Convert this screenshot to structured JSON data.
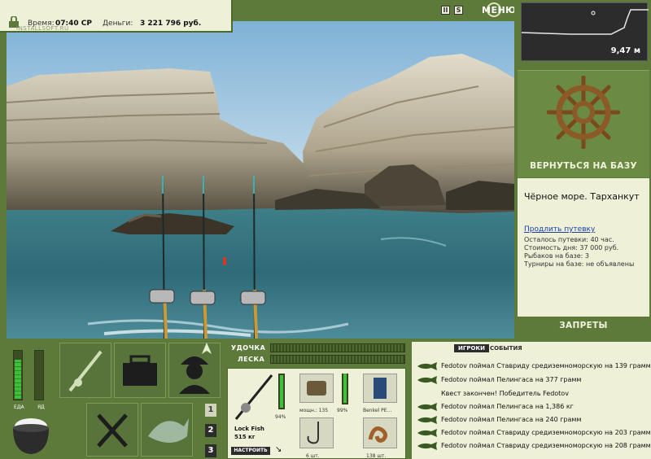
{
  "status": {
    "time_label": "Время:",
    "time_value": "07:40 СР",
    "money_label": "Деньги:",
    "money_value": "3 221 796 руб.",
    "watermark": "INSTALLSOFT.RU"
  },
  "toolbar": {
    "pause_label": "II",
    "sound_label": "S",
    "menu_label": "МЕНЮ"
  },
  "minimap": {
    "depth": "9,47 м"
  },
  "right_panel": {
    "return_label": "ВЕРНУТЬСЯ НА БАЗУ",
    "location": "Чёрное море. Тарханкут",
    "extend_link": "Продлить путевку",
    "info_lines": [
      "Осталось путевки: 40 час.",
      "Стоимость дня: 37 000 руб.",
      "Рыбаков на базе: 3",
      "Турниры на базе: не объявлены"
    ],
    "bans_label": "ЗАПРЕТЫ"
  },
  "meters": {
    "food_label": "ЕДА",
    "poison_label": "ЯД",
    "food_level": 0.8,
    "poison_level": 0.0
  },
  "bars": {
    "rod_label": "УДОЧКА",
    "line_label": "ЛЕСКА"
  },
  "side_buttons": [
    "1",
    "2",
    "3"
  ],
  "rod_panel": {
    "rod_name": "Lock Fish",
    "rod_weight": "515 кг",
    "rod_pct": "94%",
    "setup_label": "НАСТРОИТЬ",
    "reel_power": "мощн.: 135",
    "reel_pct": "99%",
    "line_name": "Benkel PE...",
    "hook_count": "6 шт.",
    "bait_count": "138 шт."
  },
  "events": {
    "tab_players": "ИГРОКИ",
    "tab_events": "СОБЫТИЯ",
    "rows": [
      {
        "text": "Fedotov поймал Ставриду средиземноморскую на 139 грамм",
        "fish": true
      },
      {
        "text": "Fedotov поймал Пелингаса на 377 грамм",
        "fish": true
      },
      {
        "text": "Квест закончен! Победитель Fedotov",
        "fish": false
      },
      {
        "text": "Fedotov поймал Пелингаса на 1,386 кг",
        "fish": true
      },
      {
        "text": "Fedotov поймал Пелингаса на 240 грамм",
        "fish": true
      },
      {
        "text": "Fedotov поймал Ставриду средиземноморскую на 203 грамм",
        "fish": true
      },
      {
        "text": "Fedotov поймал Ставриду средиземноморскую на 208 грамм",
        "fish": true
      }
    ]
  },
  "colors": {
    "panel_green": "#5d7a3a",
    "cream": "#eef0d8",
    "link_blue": "#1a3fa8"
  }
}
